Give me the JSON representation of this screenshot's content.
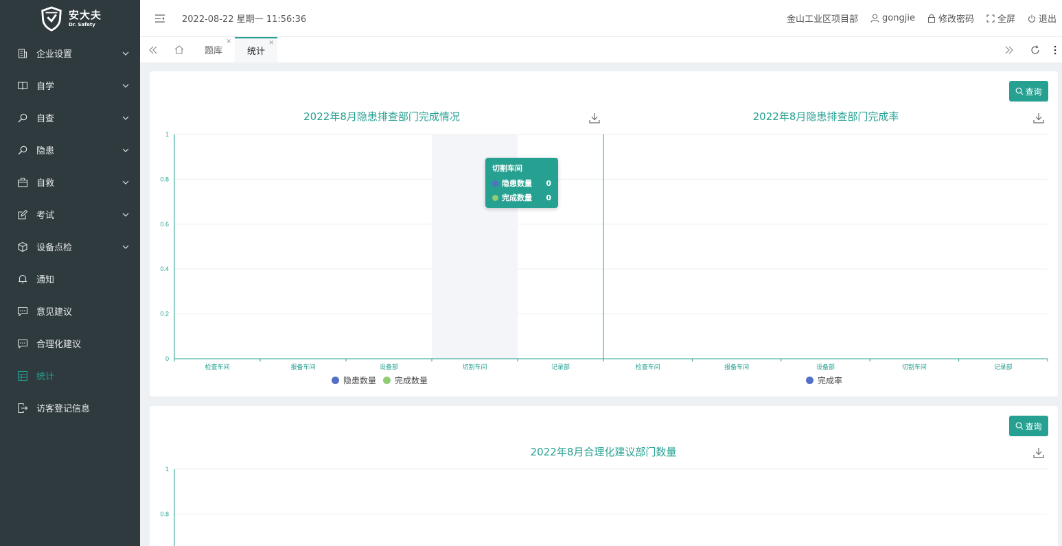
{
  "app": {
    "brand_cn": "安大夫",
    "brand_en": "Dr. Safety",
    "accent": "#26a091"
  },
  "sidebar": {
    "items": [
      {
        "label": "企业设置",
        "icon": "building-icon",
        "expandable": true
      },
      {
        "label": "自学",
        "icon": "book-icon",
        "expandable": true
      },
      {
        "label": "自查",
        "icon": "search-icon",
        "expandable": true
      },
      {
        "label": "隐患",
        "icon": "search-icon",
        "expandable": true
      },
      {
        "label": "自救",
        "icon": "briefcase-icon",
        "expandable": true
      },
      {
        "label": "考试",
        "icon": "edit-icon",
        "expandable": true
      },
      {
        "label": "设备点检",
        "icon": "cube-icon",
        "expandable": true
      },
      {
        "label": "通知",
        "icon": "bell-icon",
        "expandable": false
      },
      {
        "label": "意见建议",
        "icon": "message-icon",
        "expandable": false
      },
      {
        "label": "合理化建议",
        "icon": "message-icon",
        "expandable": false
      },
      {
        "label": "统计",
        "icon": "chart-icon",
        "expandable": false,
        "active": true
      },
      {
        "label": "访客登记信息",
        "icon": "exit-icon",
        "expandable": false
      }
    ]
  },
  "header": {
    "datetime": "2022-08-22 星期一 11:56:36",
    "project": "金山工业区项目部",
    "user": "gongjie",
    "change_password": "修改密码",
    "fullscreen": "全屏",
    "logout": "退出"
  },
  "tabs": [
    {
      "label": "题库",
      "active": false
    },
    {
      "label": "统计",
      "active": true
    }
  ],
  "card1": {
    "query_label": "查询",
    "tooltip": {
      "title": "切割车间",
      "rows": [
        {
          "name": "隐患数量",
          "value": "0",
          "color": "#5470c6"
        },
        {
          "name": "完成数量",
          "value": "0",
          "color": "#91cc75"
        }
      ]
    }
  },
  "card2": {
    "query_label": "查询"
  },
  "chart_data": [
    {
      "type": "bar",
      "title": "2022年8月隐患排查部门完成情况",
      "categories": [
        "检查车间",
        "报备车间",
        "设备部",
        "切割车间",
        "记录部"
      ],
      "series": [
        {
          "name": "隐患数量",
          "values": [
            0,
            0,
            0,
            0,
            0
          ],
          "color": "#5470c6"
        },
        {
          "name": "完成数量",
          "values": [
            0,
            0,
            0,
            0,
            0
          ],
          "color": "#91cc75"
        }
      ],
      "yticks": [
        "0",
        "0.2",
        "0.4",
        "0.6",
        "0.8",
        "1"
      ],
      "ylim": [
        0,
        1
      ],
      "legend": "bottom"
    },
    {
      "type": "bar",
      "title": "2022年8月隐患排查部门完成率",
      "categories": [
        "检查车间",
        "报备车间",
        "设备部",
        "切割车间",
        "记录部"
      ],
      "series": [
        {
          "name": "完成率",
          "values": [
            0,
            0,
            0,
            0,
            0
          ],
          "color": "#5470c6"
        }
      ],
      "ylim": [
        0,
        1
      ],
      "legend": "bottom"
    },
    {
      "type": "bar",
      "title": "2022年8月合理化建议部门数量",
      "yticks": [
        "0.8",
        "1"
      ],
      "ylim": [
        0,
        1
      ]
    }
  ]
}
